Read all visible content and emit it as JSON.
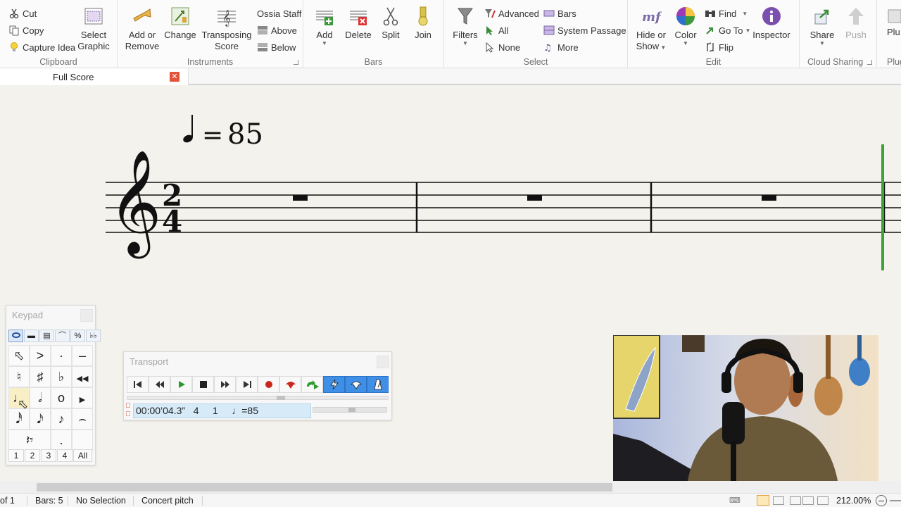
{
  "ribbon": {
    "clipboard": {
      "label": "Clipboard",
      "cut": "Cut",
      "copy": "Copy",
      "capture_idea": "Capture Idea",
      "select_graphic": [
        "Select",
        "Graphic"
      ]
    },
    "instruments": {
      "label": "Instruments",
      "add_or_remove": [
        "Add or",
        "Remove"
      ],
      "change": "Change",
      "transposing_score": [
        "Transposing",
        "Score"
      ],
      "ossia_staff": "Ossia Staff",
      "above": "Above",
      "below": "Below"
    },
    "bars": {
      "label": "Bars",
      "add": "Add",
      "delete": "Delete",
      "split": "Split",
      "join": "Join"
    },
    "select": {
      "label": "Select",
      "filters": "Filters",
      "advanced": "Advanced",
      "all": "All",
      "none": "None",
      "bars": "Bars",
      "system_passage": "System Passage",
      "more": "More"
    },
    "edit": {
      "label": "Edit",
      "hide_or_show": [
        "Hide or",
        "Show"
      ],
      "color": "Color",
      "find": "Find",
      "go_to": "Go To",
      "flip": "Flip",
      "inspector": "Inspector"
    },
    "cloud": {
      "label": "Cloud Sharing",
      "share": "Share",
      "push": "Push"
    },
    "plugins": {
      "label": "Plug",
      "button": "Plu"
    }
  },
  "tabs": {
    "full_score": "Full Score"
  },
  "score": {
    "tempo_value": "85",
    "time_signature": {
      "top": "2",
      "bottom": "4"
    },
    "bar_count_visible": 3
  },
  "keypad": {
    "title": "Keypad",
    "layouts": [
      "1",
      "2",
      "3",
      "4",
      "All"
    ]
  },
  "transport": {
    "title": "Transport",
    "time": "00:00’04.3”",
    "bar": "4",
    "beat": "1",
    "tempo": "85",
    "position_fraction": 0.59
  },
  "status": {
    "page": "of 1",
    "bars": "Bars: 5",
    "selection": "No Selection",
    "pitch": "Concert pitch",
    "zoom": "212.00%"
  },
  "colors": {
    "accent": "#3f8fe6",
    "playback_line": "#3aa536",
    "close": "#e2533a",
    "transport_display": "#d6eaf7"
  }
}
